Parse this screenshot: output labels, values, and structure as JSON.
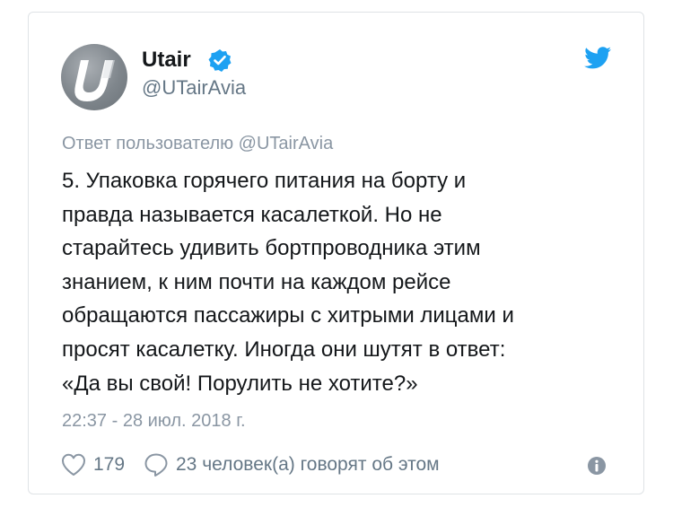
{
  "header": {
    "display_name": "Utair",
    "handle": "@UTairAvia",
    "verified": true,
    "avatar_letter": "U"
  },
  "tweet": {
    "reply_to": "Ответ пользователю @UTairAvia",
    "text_lines": [
      "5. Упаковка горячего питания на борту и",
      "правда называется касалеткой. Но не",
      "старайтесь удивить бортпроводника этим",
      "знанием, к ним почти на каждом рейсе",
      "обращаются пассажиры с хитрыми лицами и",
      "просят касалетку. Иногда они шутят в ответ:",
      "«Да вы свой! Порулить не хотите?»"
    ],
    "timestamp": "22:37 - 28 июл. 2018 г."
  },
  "actions": {
    "likes": "179",
    "replies_label": "23 человек(а) говорят об этом"
  },
  "icons": {
    "brand": "twitter-bird-icon",
    "verified": "verified-badge-icon",
    "like": "heart-icon",
    "reply": "speech-bubble-icon",
    "info": "info-icon"
  },
  "colors": {
    "twitter_blue": "#1da1f2",
    "text": "#14171a",
    "muted": "#657786",
    "avatar": "#7f868c"
  }
}
